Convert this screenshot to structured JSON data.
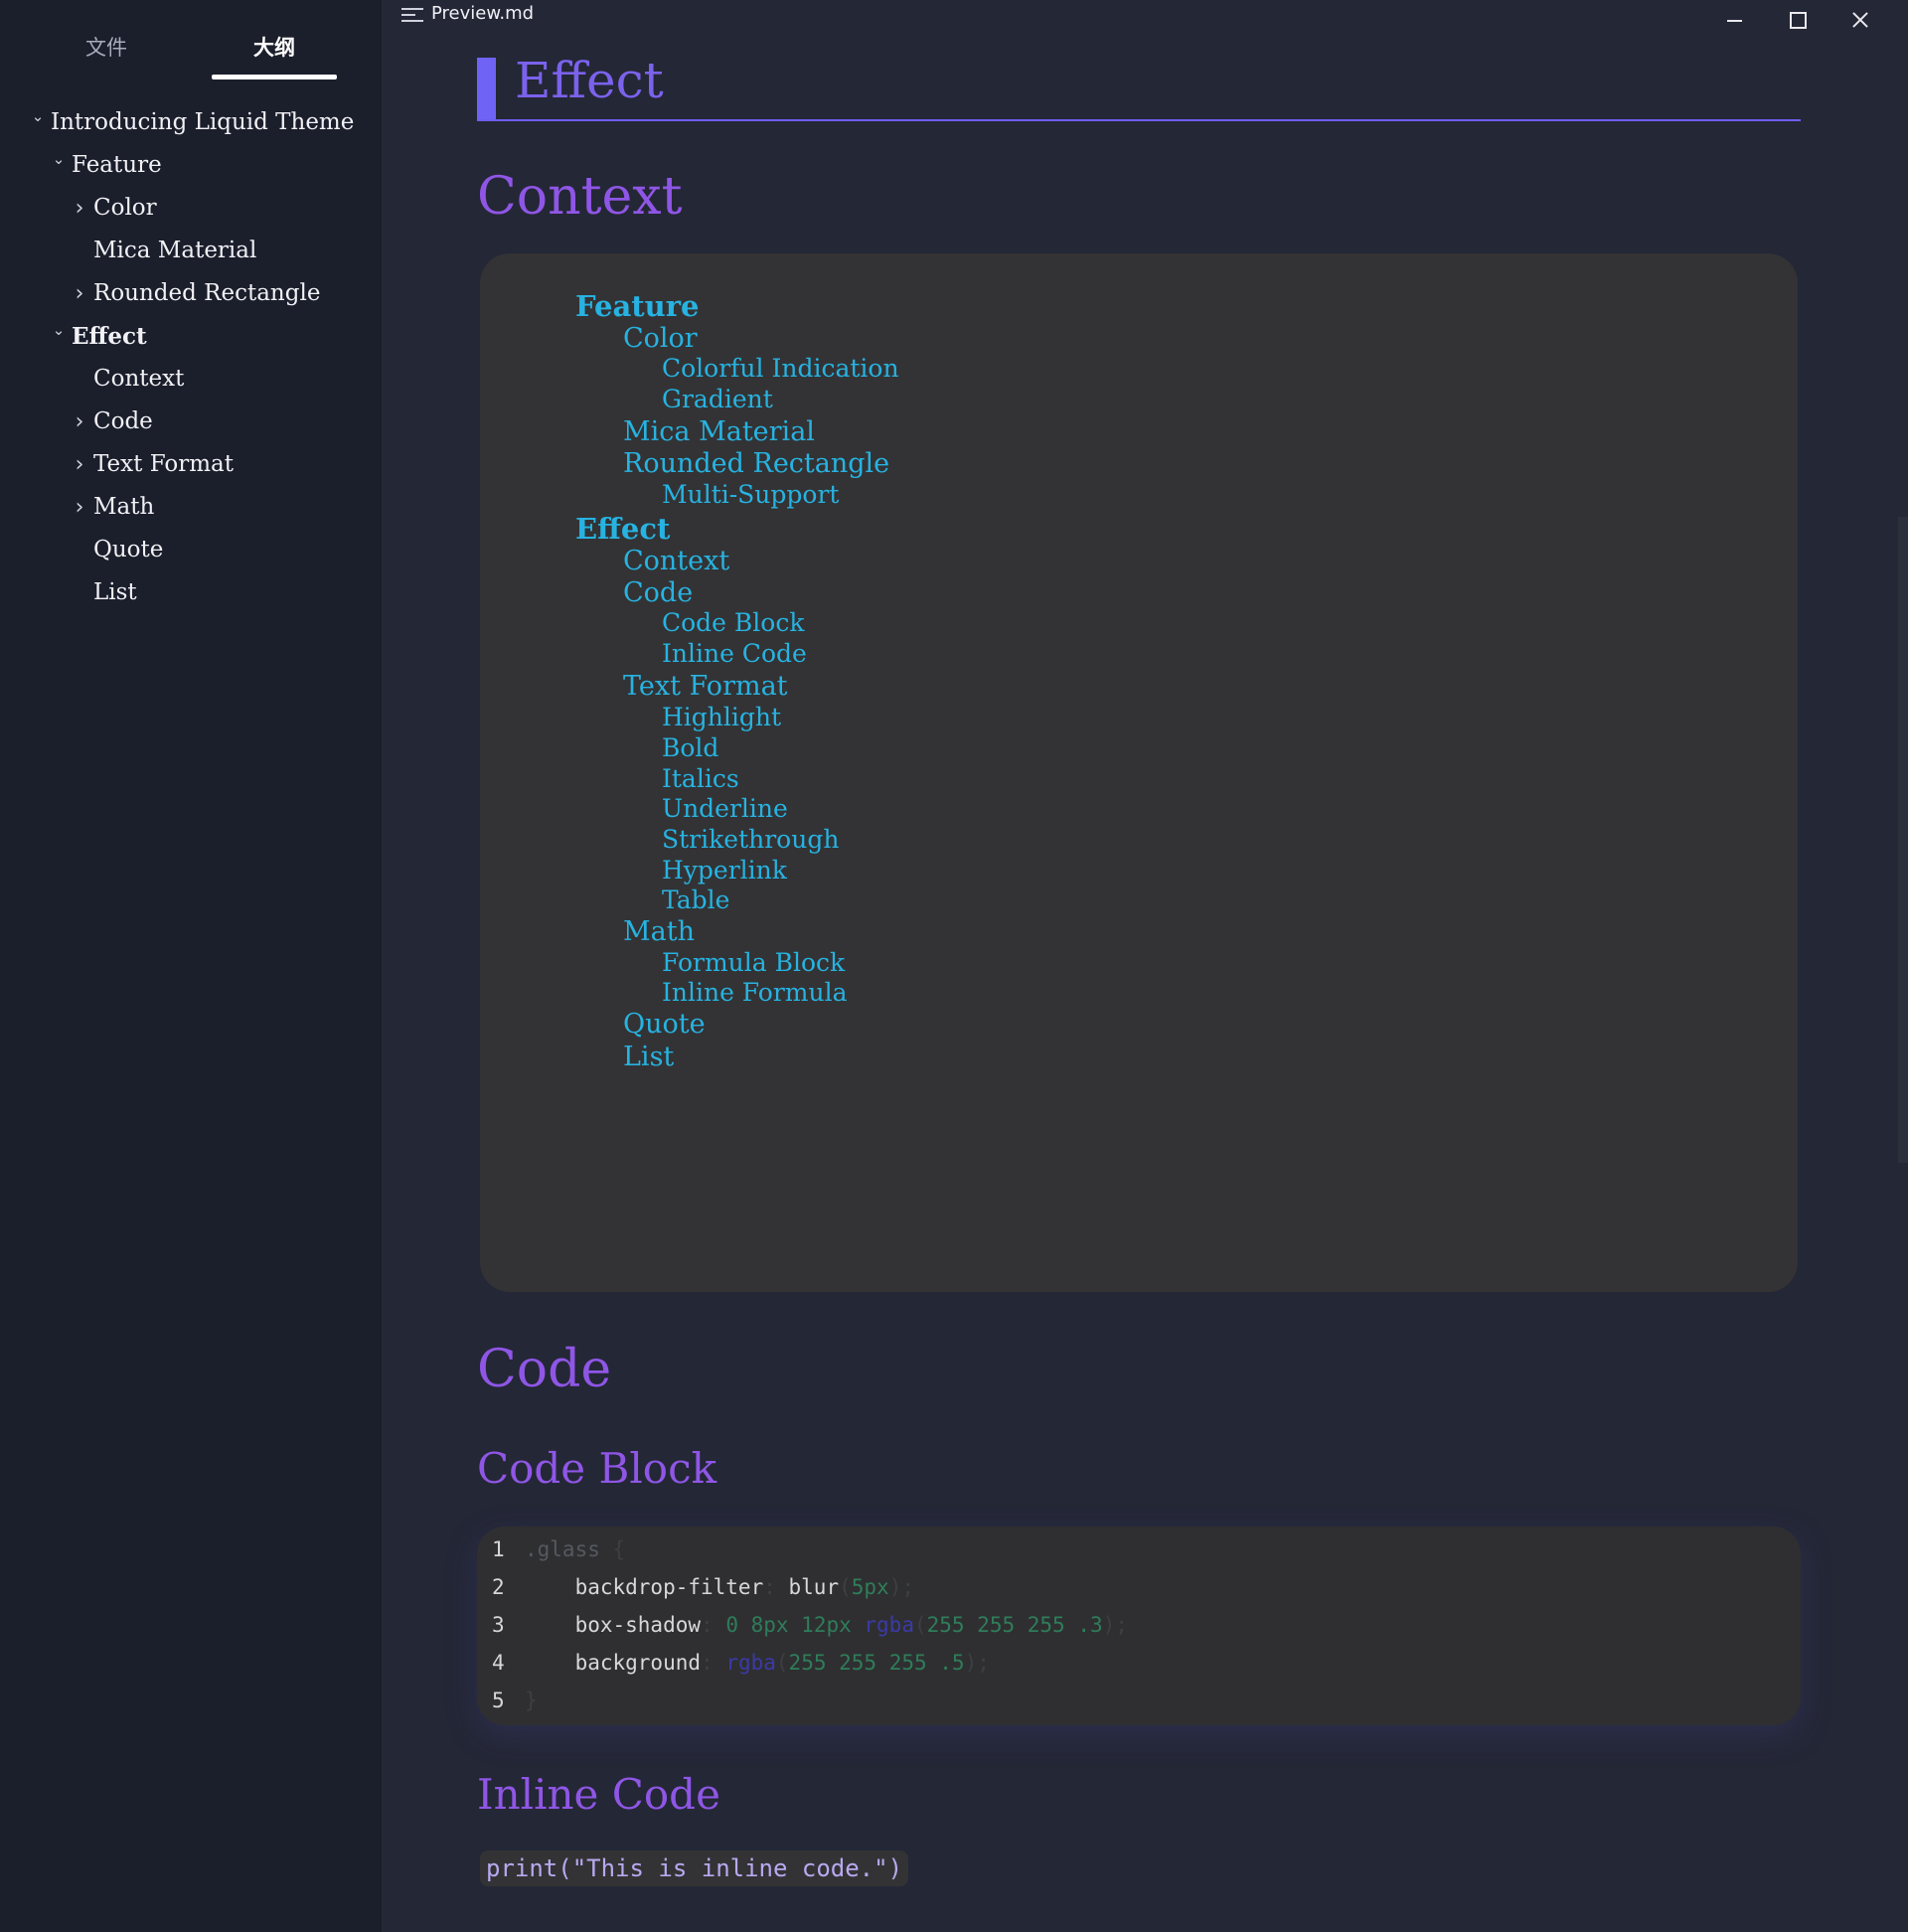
{
  "window": {
    "title": "Preview.md",
    "minimize": "minimize",
    "maximize": "maximize",
    "close": "close"
  },
  "sidebar": {
    "tabs": [
      {
        "label": "文件",
        "active": false
      },
      {
        "label": "大纲",
        "active": true
      }
    ],
    "outline": [
      {
        "label": "Introducing Liquid Theme",
        "level": 1,
        "chevron": "expanded",
        "bold": false
      },
      {
        "label": "Feature",
        "level": 2,
        "chevron": "expanded",
        "bold": false
      },
      {
        "label": "Color",
        "level": 3,
        "chevron": "collapsed",
        "bold": false
      },
      {
        "label": "Mica Material",
        "level": 3,
        "chevron": "none",
        "bold": false
      },
      {
        "label": "Rounded Rectangle",
        "level": 3,
        "chevron": "collapsed",
        "bold": false
      },
      {
        "label": "Effect",
        "level": 2,
        "chevron": "expanded",
        "bold": true
      },
      {
        "label": "Context",
        "level": 3,
        "chevron": "none",
        "bold": false
      },
      {
        "label": "Code",
        "level": 3,
        "chevron": "collapsed",
        "bold": false
      },
      {
        "label": "Text Format",
        "level": 3,
        "chevron": "collapsed",
        "bold": false
      },
      {
        "label": "Math",
        "level": 3,
        "chevron": "collapsed",
        "bold": false
      },
      {
        "label": "Quote",
        "level": 3,
        "chevron": "none",
        "bold": false
      },
      {
        "label": "List",
        "level": 3,
        "chevron": "none",
        "bold": false
      }
    ]
  },
  "content": {
    "h1": "Effect",
    "context_heading": "Context",
    "toc": [
      {
        "label": "Feature",
        "level": 1
      },
      {
        "label": "Color",
        "level": 2
      },
      {
        "label": "Colorful Indication",
        "level": 3
      },
      {
        "label": "Gradient",
        "level": 3
      },
      {
        "label": "Mica Material",
        "level": 2
      },
      {
        "label": "Rounded Rectangle",
        "level": 2
      },
      {
        "label": "Multi-Support",
        "level": 3
      },
      {
        "label": "Effect",
        "level": 1
      },
      {
        "label": "Context",
        "level": 2
      },
      {
        "label": "Code",
        "level": 2
      },
      {
        "label": "Code Block",
        "level": 3
      },
      {
        "label": "Inline Code",
        "level": 3
      },
      {
        "label": "Text Format",
        "level": 2
      },
      {
        "label": "Highlight",
        "level": 3
      },
      {
        "label": "Bold",
        "level": 3
      },
      {
        "label": "Italics",
        "level": 3
      },
      {
        "label": "Underline",
        "level": 3
      },
      {
        "label": "Strikethrough",
        "level": 3
      },
      {
        "label": "Hyperlink",
        "level": 3
      },
      {
        "label": "Table",
        "level": 3
      },
      {
        "label": "Math",
        "level": 2
      },
      {
        "label": "Formula Block",
        "level": 3
      },
      {
        "label": "Inline Formula",
        "level": 3
      },
      {
        "label": "Quote",
        "level": 2
      },
      {
        "label": "List",
        "level": 2
      }
    ],
    "code_heading": "Code",
    "code_block_heading": "Code Block",
    "code_lines": [
      {
        "n": "1",
        "tokens": [
          {
            "t": ".glass",
            "c": "c-sel"
          },
          {
            "t": " {",
            "c": "c-dim"
          }
        ]
      },
      {
        "n": "2",
        "tokens": [
          {
            "t": "    backdrop-filter",
            "c": "c-prop"
          },
          {
            "t": ": ",
            "c": "c-dim"
          },
          {
            "t": "blur",
            "c": "c-prop"
          },
          {
            "t": "(",
            "c": "c-dim"
          },
          {
            "t": "5px",
            "c": "c-num"
          },
          {
            "t": ");",
            "c": "c-dim"
          }
        ]
      },
      {
        "n": "3",
        "tokens": [
          {
            "t": "    box-shadow",
            "c": "c-prop"
          },
          {
            "t": ": ",
            "c": "c-dim"
          },
          {
            "t": "0 8px 12px ",
            "c": "c-num"
          },
          {
            "t": "rgba",
            "c": "c-fn"
          },
          {
            "t": "(",
            "c": "c-dim"
          },
          {
            "t": "255 255 255 .3",
            "c": "c-num"
          },
          {
            "t": ");",
            "c": "c-dim"
          }
        ]
      },
      {
        "n": "4",
        "tokens": [
          {
            "t": "    background",
            "c": "c-prop"
          },
          {
            "t": ": ",
            "c": "c-dim"
          },
          {
            "t": "rgba",
            "c": "c-fn"
          },
          {
            "t": "(",
            "c": "c-dim"
          },
          {
            "t": "255 255 255 .5",
            "c": "c-num"
          },
          {
            "t": ");",
            "c": "c-dim"
          }
        ]
      },
      {
        "n": "5",
        "tokens": [
          {
            "t": "}",
            "c": "c-dim"
          }
        ]
      }
    ],
    "inline_code_heading": "Inline Code",
    "inline_code": "print(\"This is inline code.\")"
  },
  "colors": {
    "accent": "#6f63f5",
    "heading": "#8f56e6",
    "link": "#27b3e1",
    "sidebar_bg": "#1b1e2b",
    "editor_bg": "#242736"
  },
  "icons": {
    "file": "menu-lines-icon",
    "chevron_expanded": "chevron-down-icon",
    "chevron_collapsed": "chevron-right-icon"
  }
}
